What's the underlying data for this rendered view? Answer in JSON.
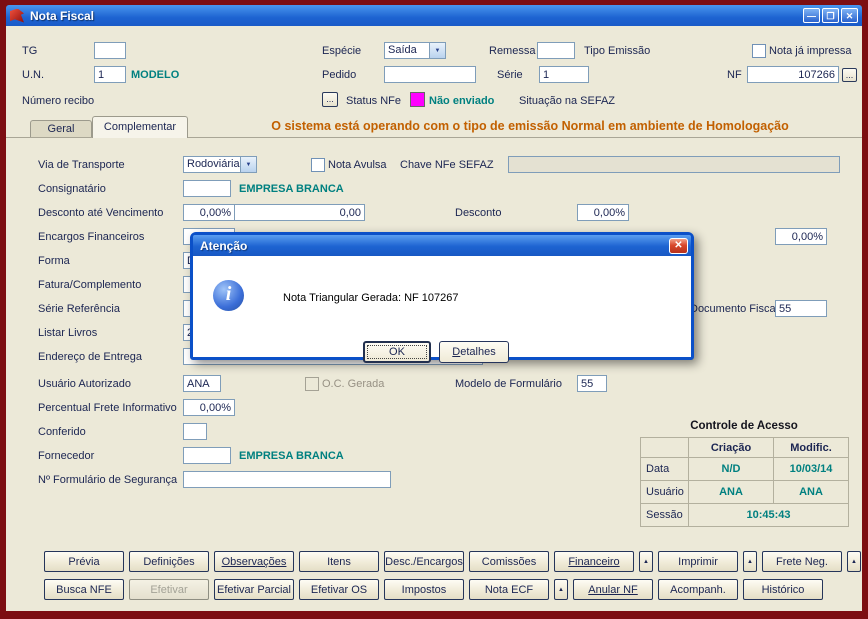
{
  "colors": {
    "frame": "#7C0E12",
    "titlebar_blue": "#1D63D1",
    "panel_beige": "#ECE9D8",
    "teal_accent": "#008080",
    "banner_orange": "#C26000",
    "status_magenta": "#FF00FF",
    "field_border": "#7F9DB9"
  },
  "icons": {
    "minimize": "—",
    "maximize": "❐",
    "close": "✕",
    "dialog_close": "✕",
    "ellipsis": "...",
    "dropdown": "▼",
    "up_arrow": "▲",
    "info": "i"
  },
  "titlebar": {
    "title": "Nota Fiscal"
  },
  "top": {
    "tg_label": "TG",
    "tg_value": "",
    "especie_label": "Espécie",
    "especie_value": "Saída",
    "remessa_label": "Remessa",
    "remessa_value": "",
    "tipo_emissao_label": "Tipo Emissão",
    "nota_impressa_label": "Nota já impressa",
    "un_label": "U.N.",
    "un_value": "1",
    "modelo_label": "MODELO",
    "pedido_label": "Pedido",
    "pedido_value": "",
    "serie_label": "Série",
    "serie_value": "1",
    "nf_label": "NF",
    "nf_value": "107266",
    "numero_recibo_label": "Número recibo",
    "status_nfe_label": "Status NFe",
    "status_nfe_value": "Não enviado",
    "situacao_label": "Situação na SEFAZ"
  },
  "tabs": {
    "geral": "Geral",
    "complementar": "Complementar",
    "banner": "O sistema está operando com o tipo de emissão Normal em ambiente de Homologação"
  },
  "form": {
    "via_transporte_label": "Via de Transporte",
    "via_transporte_value": "Rodoviária",
    "nota_avulsa_label": "Nota Avulsa",
    "chave_label": "Chave NFe SEFAZ",
    "chave_value": "",
    "consignatario_label": "Consignatário",
    "consignatario_value": "",
    "consignatario_company": "EMPRESA BRANCA",
    "desconto_venc_label": "Desconto até Vencimento",
    "desconto_venc_pct": "0,00%",
    "desconto_venc_valor": "0,00",
    "desconto_label": "Desconto",
    "desconto_pct": "0,00%",
    "encargos_label": "Encargos Financeiros",
    "encargos_value": "",
    "encargos_pct": "0,00%",
    "forma_label": "Forma",
    "forma_value": "D",
    "fatura_label": "Fatura/Complemento",
    "fatura_value": "",
    "serie_ref_label": "Série Referência",
    "serie_ref_value": "",
    "doc_fiscal_label": "Documento Fiscal",
    "doc_fiscal_value": "55",
    "listar_livros_label": "Listar Livros",
    "listar_livros_value": "2",
    "endereco_label": "Endereço de Entrega",
    "endereco_value": "",
    "usuario_aut_label": "Usuário Autorizado",
    "usuario_aut_value": "ANA",
    "oc_gerada_label": "O.C. Gerada",
    "modelo_form_label": "Modelo de Formulário",
    "modelo_form_value": "55",
    "perc_frete_label": "Percentual Frete Informativo",
    "perc_frete_value": "0,00%",
    "conferido_label": "Conferido",
    "conferido_value": "",
    "fornecedor_label": "Fornecedor",
    "fornecedor_value": "",
    "fornecedor_company": "EMPRESA BRANCA",
    "form_seg_label": "Nº Formulário de Segurança",
    "form_seg_value": ""
  },
  "dialog": {
    "title": "Atenção",
    "message": "Nota Triangular Gerada: NF 107267",
    "ok_label": "OK",
    "detalhes_label": "Detalhes"
  },
  "access": {
    "title": "Controle de Acesso",
    "col_criacao": "Criação",
    "col_modific": "Modific.",
    "row_data_label": "Data",
    "data_criacao": "N/D",
    "data_modific": "10/03/14",
    "row_usuario_label": "Usuário",
    "usuario_criacao": "ANA",
    "usuario_modific": "ANA",
    "row_sessao_label": "Sessão",
    "sessao_value": "10:45:43"
  },
  "buttons": {
    "row1": [
      "Prévia",
      "Definições",
      "Observações",
      "Itens",
      "Desc./Encargos",
      "Comissões",
      "Financeiro",
      "Imprimir",
      "Frete Neg."
    ],
    "row2": [
      "Busca NFE",
      "Efetivar",
      "Efetivar Parcial",
      "Efetivar OS",
      "Impostos",
      "Nota ECF",
      "Anular NF",
      "Acompanh.",
      "Histórico"
    ]
  }
}
